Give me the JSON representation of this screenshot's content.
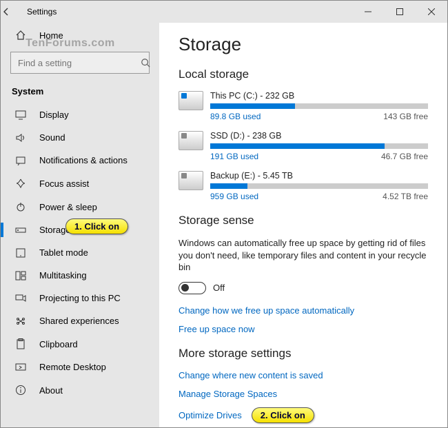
{
  "titlebar": {
    "title": "Settings"
  },
  "sidebar": {
    "home": "Home",
    "search_placeholder": "Find a setting",
    "section": "System",
    "items": [
      {
        "label": "Display"
      },
      {
        "label": "Sound"
      },
      {
        "label": "Notifications & actions"
      },
      {
        "label": "Focus assist"
      },
      {
        "label": "Power & sleep"
      },
      {
        "label": "Storage"
      },
      {
        "label": "Tablet mode"
      },
      {
        "label": "Multitasking"
      },
      {
        "label": "Projecting to this PC"
      },
      {
        "label": "Shared experiences"
      },
      {
        "label": "Clipboard"
      },
      {
        "label": "Remote Desktop"
      },
      {
        "label": "About"
      }
    ]
  },
  "watermark": "TenForums.com",
  "page": {
    "title": "Storage",
    "local_heading": "Local storage",
    "drives": [
      {
        "name": "This PC (C:) - 232 GB",
        "used": "89.8 GB used",
        "free": "143 GB free",
        "pct": 39
      },
      {
        "name": "SSD (D:) - 238 GB",
        "used": "191 GB used",
        "free": "46.7 GB free",
        "pct": 80
      },
      {
        "name": "Backup (E:) - 5.45 TB",
        "used": "959 GB used",
        "free": "4.52 TB free",
        "pct": 17
      }
    ],
    "sense_heading": "Storage sense",
    "sense_desc": "Windows can automatically free up space by getting rid of files you don't need, like temporary files and content in your recycle bin",
    "toggle_label": "Off",
    "link_auto": "Change how we free up space automatically",
    "link_freeup": "Free up space now",
    "more_heading": "More storage settings",
    "link_newcontent": "Change where new content is saved",
    "link_spaces": "Manage Storage Spaces",
    "link_optimize": "Optimize Drives"
  },
  "callouts": {
    "one": "1. Click on",
    "two": "2. Click on"
  }
}
